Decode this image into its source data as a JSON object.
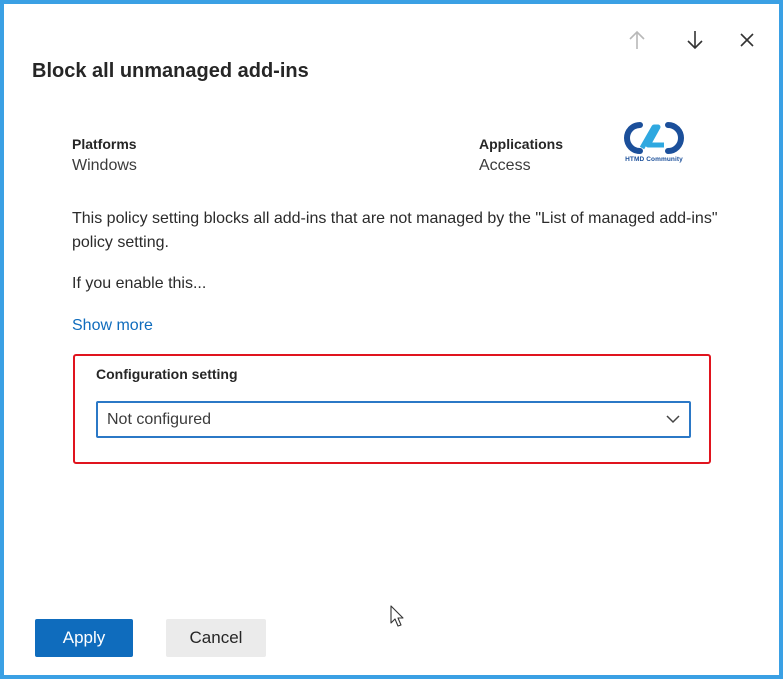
{
  "dialog": {
    "title": "Block all unmanaged add-ins"
  },
  "header_buttons": {
    "prev_icon": "arrow-up-icon",
    "next_icon": "arrow-down-icon",
    "close_icon": "close-icon"
  },
  "meta": {
    "platforms_label": "Platforms",
    "platforms_value": "Windows",
    "applications_label": "Applications",
    "applications_value": "Access"
  },
  "logo": {
    "caption": "HTMD Community",
    "color": "#1b4f9a",
    "accent": "#2fa8e0"
  },
  "description": "This policy setting blocks all add-ins that are not managed by the \"List of managed add-ins\" policy setting.",
  "enable_text": "If you enable this...",
  "show_more_label": "Show more",
  "configuration": {
    "label": "Configuration setting",
    "selected_value": "Not configured",
    "highlight_color": "#e0141e"
  },
  "footer": {
    "apply_label": "Apply",
    "cancel_label": "Cancel"
  },
  "colors": {
    "frame_border": "#3aa0e4",
    "primary": "#0f6cbd",
    "link": "#0f6cbd"
  }
}
